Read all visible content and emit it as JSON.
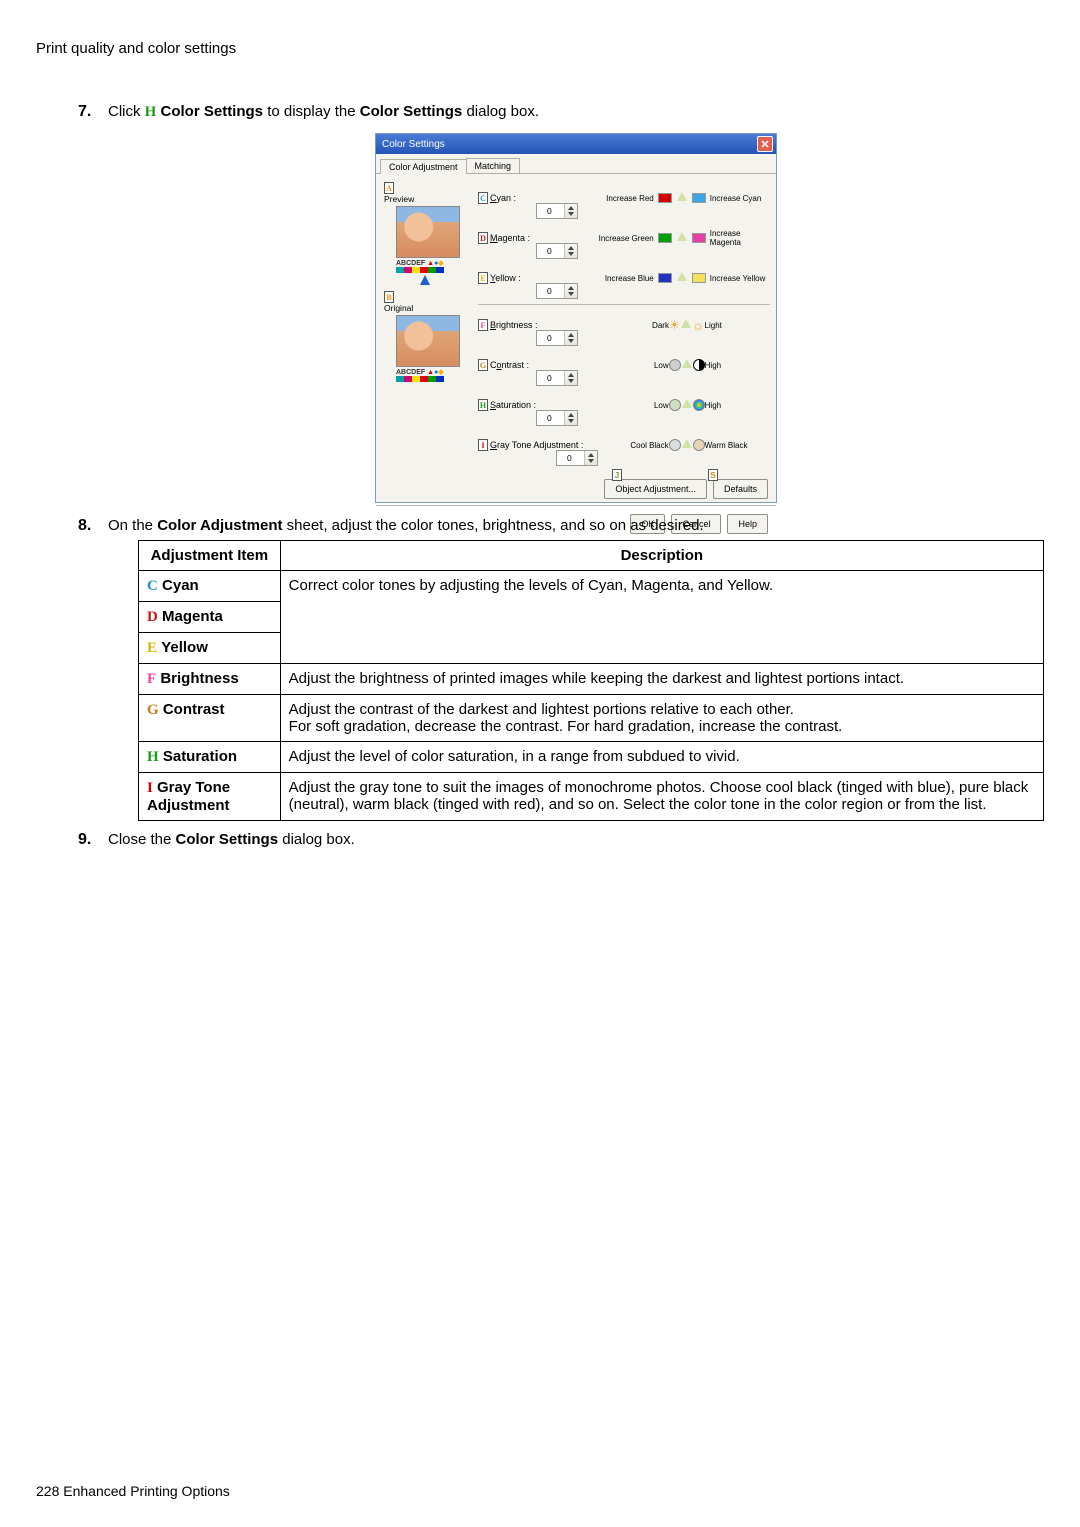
{
  "page": {
    "section_title": "Print quality and color settings",
    "footer": "228  Enhanced Printing Options"
  },
  "steps": {
    "s7": {
      "num": "7.",
      "pre": "Click ",
      "letter": "H",
      "mid": " Color Settings",
      "post": " to display the ",
      "bold2": "Color Settings",
      "tail": " dialog box."
    },
    "s8": {
      "num": "8.",
      "pre": "On the ",
      "bold": "Color Adjustment",
      "post": " sheet, adjust the color tones, brightness, and so on as desired."
    },
    "s9": {
      "num": "9.",
      "pre": "Close the ",
      "bold": "Color Settings",
      "post": " dialog box."
    }
  },
  "dlg": {
    "title": "Color Settings",
    "tabs": {
      "t1": "Color Adjustment",
      "t2": "Matching"
    },
    "preview": {
      "letterA": "A",
      "labelA": "Preview",
      "letterB": "B",
      "labelB": "Original",
      "caption": "ABCDEF"
    },
    "rows": {
      "cyan": {
        "letter": "C",
        "label": "Cyan :",
        "val": "0",
        "left": "Increase Red",
        "right": "Increase Cyan"
      },
      "magenta": {
        "letter": "D",
        "label": "Magenta :",
        "val": "0",
        "left": "Increase Green",
        "right": "Increase Magenta"
      },
      "yellow": {
        "letter": "E",
        "label": "Yellow :",
        "val": "0",
        "left": "Increase Blue",
        "right": "Increase Yellow"
      },
      "bright": {
        "letter": "F",
        "label": "Brightness :",
        "val": "0",
        "left": "Dark",
        "right": "Light"
      },
      "contrast": {
        "letter": "G",
        "label": "Contrast :",
        "val": "0",
        "left": "Low",
        "right": "High"
      },
      "sat": {
        "letter": "H",
        "label": "Saturation :",
        "val": "0",
        "left": "Low",
        "right": "High"
      },
      "gray": {
        "letter": "I",
        "label": "Gray Tone Adjustment :",
        "val": "0",
        "left": "Cool Black",
        "right": "Warm Black"
      }
    },
    "oa": {
      "letterJ": "J",
      "btn": "Object Adjustment...",
      "letterS": "S",
      "defaults": "Defaults"
    },
    "buttons": {
      "ok": "OK",
      "cancel": "Cancel",
      "help": "Help"
    }
  },
  "table": {
    "head": {
      "c1": "Adjustment Item",
      "c2": "Description"
    },
    "rows": {
      "cyan": {
        "letter": "C",
        "name": "Cyan"
      },
      "magenta": {
        "letter": "D",
        "name": "Magenta"
      },
      "yellow": {
        "letter": "E",
        "name": "Yellow"
      },
      "cmy_desc": "Correct color tones by adjusting the levels of Cyan, Magenta, and Yellow.",
      "bright": {
        "letter": "F",
        "name": "Brightness",
        "desc": "Adjust the brightness of printed images while keeping the darkest and lightest portions intact."
      },
      "contrast": {
        "letter": "G",
        "name": "Contrast",
        "desc": "Adjust the contrast of the darkest and lightest portions relative to each other.\nFor soft gradation, decrease the contrast. For hard gradation, increase the contrast."
      },
      "sat": {
        "letter": "H",
        "name": "Saturation",
        "desc": "Adjust the level of color saturation, in a range from subdued to vivid."
      },
      "gray": {
        "letter": "I",
        "name": "Gray Tone Adjustment",
        "desc": "Adjust the gray tone to suit the images of monochrome photos. Choose cool black (tinged with blue), pure black (neutral), warm black (tinged with red), and so on. Select the color tone in the color region or from the list."
      }
    }
  }
}
